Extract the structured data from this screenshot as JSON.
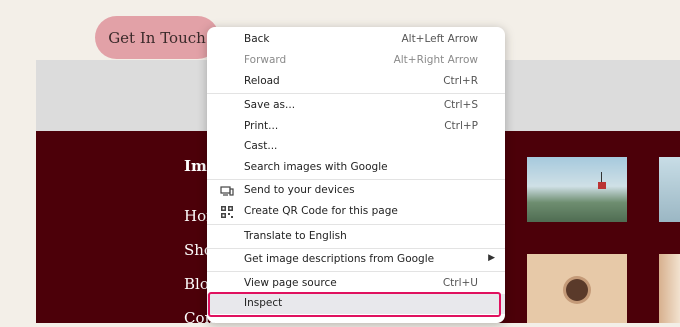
{
  "page": {
    "cta_label": "Get In Touch",
    "footer_heading": "Imp",
    "footer_links": [
      "Hom",
      "Shop",
      "Blog",
      "Contact Us"
    ]
  },
  "context_menu": {
    "items": [
      {
        "label": "Back",
        "shortcut": "Alt+Left Arrow"
      },
      {
        "label": "Forward",
        "shortcut": "Alt+Right Arrow",
        "disabled": true
      },
      {
        "label": "Reload",
        "shortcut": "Ctrl+R"
      },
      {
        "label": "Save as...",
        "shortcut": "Ctrl+S"
      },
      {
        "label": "Print...",
        "shortcut": "Ctrl+P"
      },
      {
        "label": "Cast..."
      },
      {
        "label": "Search images with Google"
      },
      {
        "label": "Send to your devices",
        "icon": "send-to-devices-icon"
      },
      {
        "label": "Create QR Code for this page",
        "icon": "qr-code-icon"
      },
      {
        "label": "Translate to English"
      },
      {
        "label": "Get image descriptions from Google",
        "icon": "submenu-arrow-icon"
      },
      {
        "label": "View page source",
        "shortcut": "Ctrl+U"
      },
      {
        "label": "Inspect"
      }
    ]
  },
  "colors": {
    "page_background": "#f3efe8",
    "cta_background": "#e2a1a7",
    "footer_background": "#4c0009",
    "inspect_highlight": "#e0115f"
  }
}
